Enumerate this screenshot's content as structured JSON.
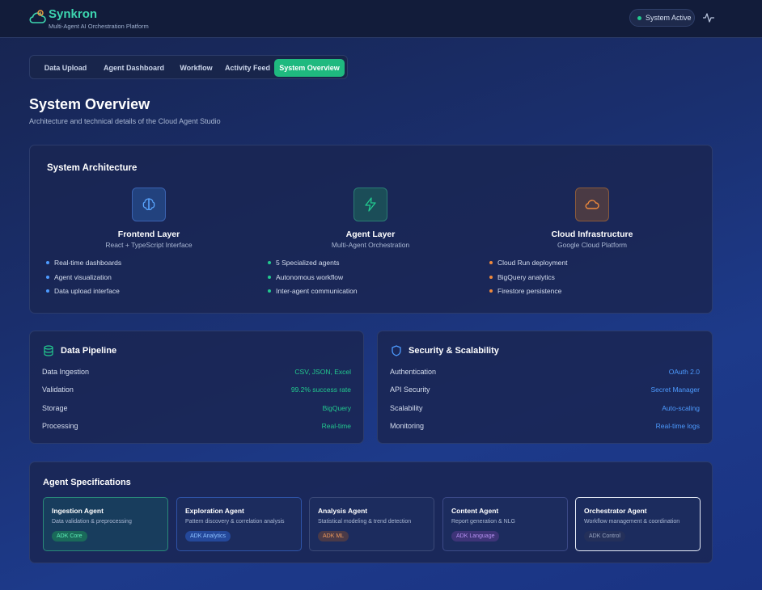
{
  "app": {
    "name": "Synkron",
    "subtitle": "Multi-Agent AI Orchestration Platform"
  },
  "status": {
    "label": "System Active",
    "color": "#22c98e"
  },
  "tabs": [
    {
      "label": "Data Upload",
      "active": false
    },
    {
      "label": "Agent Dashboard",
      "active": false
    },
    {
      "label": "Workflow",
      "active": false
    },
    {
      "label": "Activity Feed",
      "active": false
    },
    {
      "label": "System Overview",
      "active": true
    }
  ],
  "page": {
    "title": "System Overview",
    "subtitle": "Architecture and technical details of the Cloud Agent Studio"
  },
  "architecture": {
    "title": "System Architecture",
    "layers": [
      {
        "name": "Frontend Layer",
        "subtitle": "React + TypeScript Interface",
        "icon": "brain-icon",
        "accent": "#4d9bff",
        "items": [
          "Real-time dashboards",
          "Agent visualization",
          "Data upload interface"
        ]
      },
      {
        "name": "Agent Layer",
        "subtitle": "Multi-Agent Orchestration",
        "icon": "lightning-icon",
        "accent": "#22c98e",
        "items": [
          "5 Specialized agents",
          "Autonomous workflow",
          "Inter-agent communication"
        ]
      },
      {
        "name": "Cloud Infrastructure",
        "subtitle": "Google Cloud Platform",
        "icon": "cloud-icon",
        "accent": "#f08a3c",
        "items": [
          "Cloud Run deployment",
          "BigQuery analytics",
          "Firestore persistence"
        ]
      }
    ]
  },
  "pipeline": {
    "title": "Data Pipeline",
    "icon": "database-icon",
    "rows": [
      {
        "key": "Data Ingestion",
        "value": "CSV, JSON, Excel"
      },
      {
        "key": "Validation",
        "value": "99.2% success rate"
      },
      {
        "key": "Storage",
        "value": "BigQuery"
      },
      {
        "key": "Processing",
        "value": "Real-time"
      }
    ]
  },
  "security": {
    "title": "Security & Scalability",
    "icon": "shield-icon",
    "rows": [
      {
        "key": "Authentication",
        "value": "OAuth 2.0"
      },
      {
        "key": "API Security",
        "value": "Secret Manager"
      },
      {
        "key": "Scalability",
        "value": "Auto-scaling"
      },
      {
        "key": "Monitoring",
        "value": "Real-time logs"
      }
    ]
  },
  "agents": {
    "title": "Agent Specifications",
    "list": [
      {
        "name": "Ingestion Agent",
        "desc": "Data validation & preprocessing",
        "tag": "ADK Core"
      },
      {
        "name": "Exploration Agent",
        "desc": "Pattern discovery & correlation analysis",
        "tag": "ADK Analytics"
      },
      {
        "name": "Analysis Agent",
        "desc": "Statistical modeling & trend detection",
        "tag": "ADK ML"
      },
      {
        "name": "Content Agent",
        "desc": "Report generation & NLG",
        "tag": "ADK Language"
      },
      {
        "name": "Orchestrator Agent",
        "desc": "Workflow management & coordination",
        "tag": "ADK Control"
      }
    ]
  }
}
